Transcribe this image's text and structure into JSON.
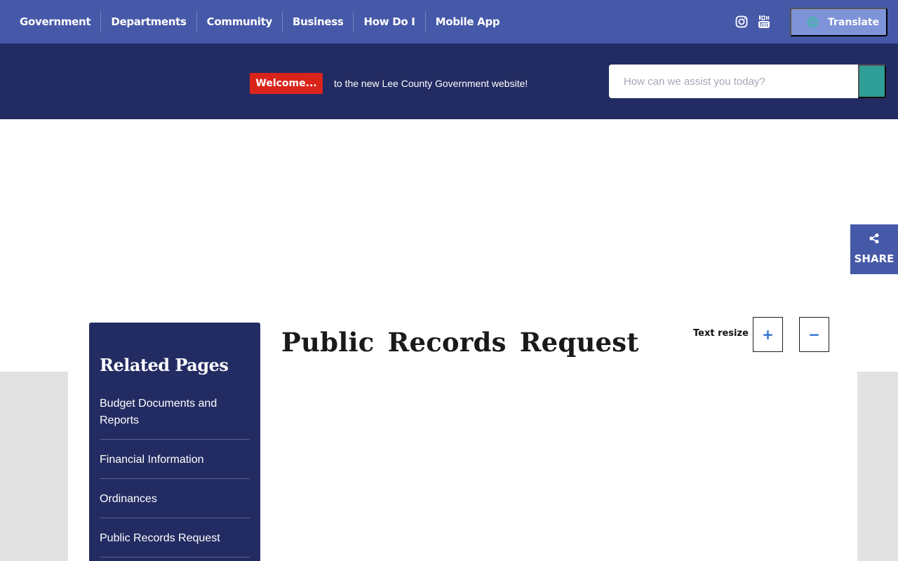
{
  "nav": {
    "items": [
      {
        "label": "Government"
      },
      {
        "label": "Departments"
      },
      {
        "label": "Community"
      },
      {
        "label": "Business"
      },
      {
        "label": "How Do I"
      },
      {
        "label": "Mobile App"
      }
    ],
    "social": [
      "instagram-icon",
      "youtube-icon"
    ],
    "translate_label": "Translate"
  },
  "welcome": {
    "badge": "Welcome...",
    "text": "to the new Lee County Government website!"
  },
  "search": {
    "placeholder": "How can we assist you today?"
  },
  "share": {
    "label": "SHARE"
  },
  "sidebar": {
    "title": "Related Pages",
    "items": [
      {
        "label": "Budget Documents and Reports"
      },
      {
        "label": "Financial Information"
      },
      {
        "label": "Ordinances"
      },
      {
        "label": "Public Records Request"
      }
    ]
  },
  "main": {
    "title": "Public Records Request",
    "text_resize_label": "Text resize",
    "increase_label": "+",
    "decrease_label": "−"
  },
  "colors": {
    "nav_bg": "#4659a8",
    "welcome_bg": "#232c62",
    "badge_red": "#d9241b",
    "search_btn": "#2e9e97",
    "translate_bg": "#7f93d9"
  }
}
